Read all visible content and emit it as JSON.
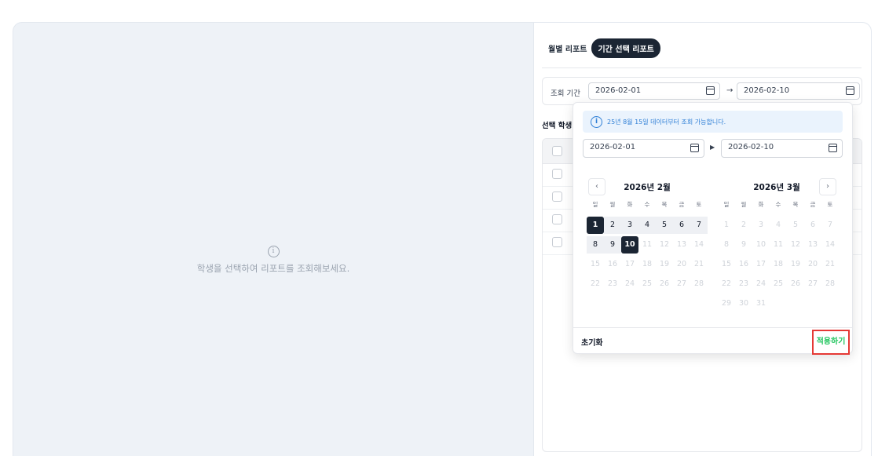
{
  "left": {
    "empty_message": "학생을 선택하여 리포트를 조회해보세요."
  },
  "tabs": [
    {
      "label": "월별 리포트",
      "active": false
    },
    {
      "label": "기간 선택 리포트",
      "active": true
    }
  ],
  "filter": {
    "label": "조회 기간",
    "start_date": "2026-02-01",
    "end_date": "2026-02-10",
    "arrow": "→"
  },
  "students": {
    "label": "선택 학생"
  },
  "popup": {
    "notice": "25년 8월 15일 데이터부터 조회 가능합니다.",
    "start_date": "2026-02-01",
    "end_date": "2026-02-10",
    "arrow": "▶",
    "prev": "‹",
    "next": "›",
    "weekdays": [
      "일",
      "월",
      "화",
      "수",
      "목",
      "금",
      "토"
    ],
    "months": [
      {
        "title": "2026년 2월"
      },
      {
        "title": "2026년 3월"
      }
    ],
    "reset_label": "초기화",
    "apply_label": "적용하기"
  },
  "colors": {
    "selected": "#1b2533",
    "apply_text": "#22c55e",
    "apply_highlight": "#e53935",
    "notice_text": "#2f7fd6"
  }
}
